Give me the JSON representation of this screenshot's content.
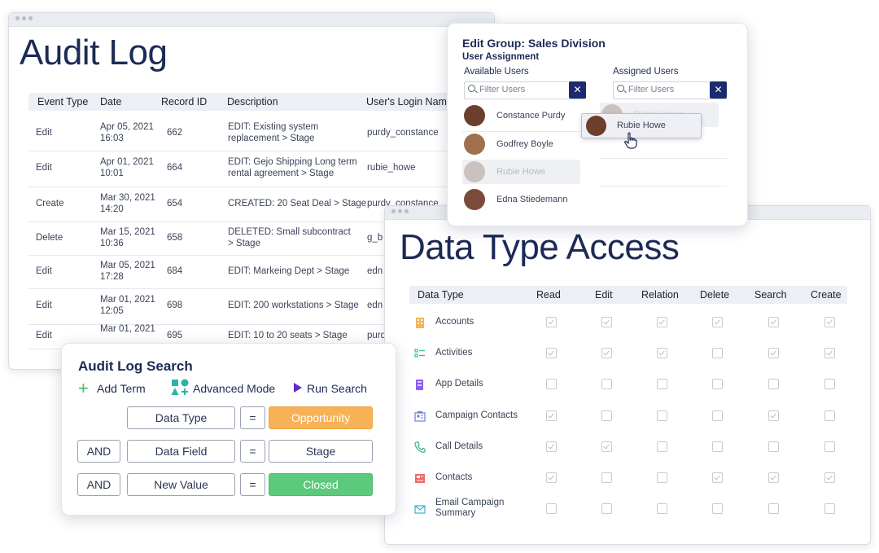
{
  "audit": {
    "title": "Audit Log",
    "headers": [
      "Event Type",
      "Date",
      "Record ID",
      "Description",
      "User's Login Name"
    ],
    "rows": [
      {
        "event": "Edit",
        "date": "Apr 05, 2021",
        "time": "16:03",
        "id": "662",
        "desc1": "EDIT: Existing system",
        "desc2": "replacement > Stage",
        "user": "purdy_constance"
      },
      {
        "event": "Edit",
        "date": "Apr 01, 2021",
        "time": "10:01",
        "id": "664",
        "desc1": "EDIT: Gejo Shipping Long term",
        "desc2": "rental agreement > Stage",
        "user": "rubie_howe"
      },
      {
        "event": "Create",
        "date": "Mar 30, 2021",
        "time": "14:20",
        "id": "654",
        "desc1": "CREATED:  20 Seat Deal > Stage",
        "desc2": "",
        "user": "purdy_constance"
      },
      {
        "event": "Delete",
        "date": "Mar 15, 2021",
        "time": "10:36",
        "id": "658",
        "desc1": "DELETED: Small subcontract",
        "desc2": "> Stage",
        "user": "g_b"
      },
      {
        "event": "Edit",
        "date": "Mar 05, 2021",
        "time": "17:28",
        "id": "684",
        "desc1": "EDIT: Markeing Dept > Stage",
        "desc2": "",
        "user": "edn"
      },
      {
        "event": "Edit",
        "date": "Mar 01, 2021",
        "time": "12:05",
        "id": "698",
        "desc1": "EDIT: 200 workstations > Stage",
        "desc2": "",
        "user": "edn"
      },
      {
        "event": "Edit",
        "date": "Mar 01, 2021",
        "time": "",
        "id": "695",
        "desc1": "EDIT: 10 to 20 seats > Stage",
        "desc2": "",
        "user": "purd"
      }
    ]
  },
  "group": {
    "title": "Edit Group: Sales Division",
    "subtitle": "User Assignment",
    "available_label": "Available Users",
    "assigned_label": "Assigned Users",
    "filter_placeholder": "Filter Users",
    "clear_glyph": "✕",
    "available_users": [
      "Constance Purdy",
      "Godfrey Boyle",
      "Rubie Howe",
      "Edna Stiedemann"
    ],
    "assigned_ghost": "Rubie Howe",
    "dragging_user": "Rubie Howe"
  },
  "dta": {
    "title": "Data Type Access",
    "headers": [
      "Data Type",
      "Read",
      "Edit",
      "Relation",
      "Delete",
      "Search",
      "Create"
    ],
    "rows": [
      {
        "label": "Accounts",
        "icon": "building-icon",
        "color": "#f2b35b",
        "checks": [
          true,
          true,
          true,
          true,
          true,
          true
        ]
      },
      {
        "label": "Activities",
        "icon": "checklist-icon",
        "color": "#3dbf8a",
        "checks": [
          true,
          true,
          true,
          false,
          true,
          true
        ]
      },
      {
        "label": "App Details",
        "icon": "app-icon",
        "color": "#8b5cf6",
        "checks": [
          false,
          false,
          false,
          false,
          false,
          false
        ]
      },
      {
        "label": "Campaign Contacts",
        "icon": "contacts-icon",
        "color": "#6d7bd6",
        "checks": [
          true,
          false,
          false,
          false,
          true,
          false
        ]
      },
      {
        "label": "Call Details",
        "icon": "phone-icon",
        "color": "#2fb27b",
        "checks": [
          true,
          true,
          false,
          false,
          false,
          false
        ]
      },
      {
        "label": "Contacts",
        "icon": "contact-card-icon",
        "color": "#ef6b6b",
        "checks": [
          true,
          false,
          false,
          true,
          true,
          true
        ]
      },
      {
        "label": "Email Campaign",
        "label2": "Summary",
        "icon": "email-icon",
        "color": "#33b3c9",
        "checks": [
          false,
          false,
          false,
          false,
          false,
          false
        ]
      }
    ]
  },
  "search": {
    "title": "Audit Log Search",
    "add_term": "Add Term",
    "advanced_mode": "Advanced Mode",
    "run_search": "Run Search",
    "terms": [
      {
        "op": "",
        "field": "Data Type",
        "eq": "=",
        "value": "Opportunity",
        "value_color": "#f7b256"
      },
      {
        "op": "AND",
        "field": "Data Field",
        "eq": "=",
        "value": "Stage",
        "value_color": "#ffffff"
      },
      {
        "op": "AND",
        "field": "New Value",
        "eq": "=",
        "value": "Closed",
        "value_color": "#5cc97c"
      }
    ]
  }
}
